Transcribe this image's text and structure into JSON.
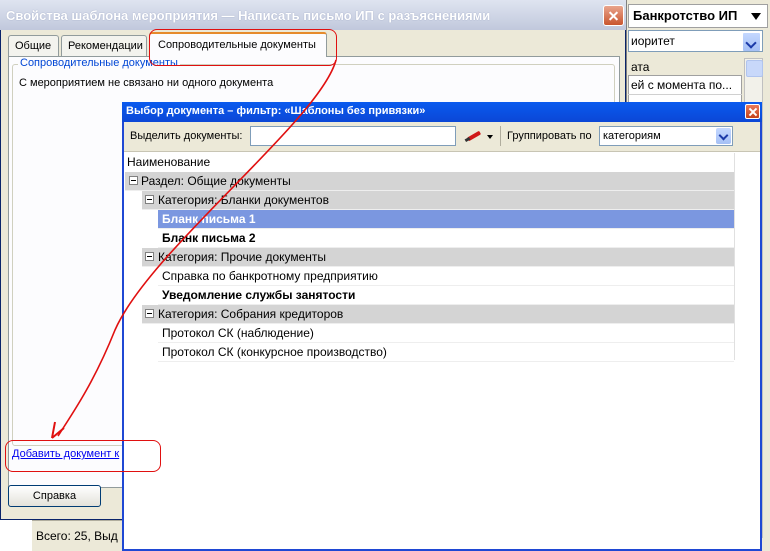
{
  "background_window": {
    "title": "Банкротство ИП",
    "combo_value": "иоритет",
    "column_header": "ата",
    "row_text": "ей с момента по..."
  },
  "dialog": {
    "title": "Свойства шаблона мероприятия — Написать письмо ИП с разъяснениями",
    "tabs": [
      {
        "label": "Общие"
      },
      {
        "label": "Рекомендации"
      },
      {
        "label": "Сопроводительные документы"
      }
    ],
    "group_legend": "Сопроводительные документы",
    "empty_message": "С мероприятием не связано ни одного документа",
    "add_link": "Добавить документ к",
    "help_button": "Справка"
  },
  "status_bar": "Всего: 25, Выд",
  "picker": {
    "title": "Выбор документа – фильтр: «Шаблоны без привязки»",
    "select_label": "Выделить документы:",
    "select_value": "",
    "group_label": "Группировать по",
    "group_value": "категориям",
    "column_header": "Наименование",
    "section": "Раздел: Общие документы",
    "categories": [
      {
        "label": "Категория: Бланки документов",
        "items": [
          {
            "label": "Бланк письма 1",
            "bold": true,
            "selected": true
          },
          {
            "label": "Бланк письма 2",
            "bold": true,
            "selected": false
          }
        ]
      },
      {
        "label": "Категория: Прочие документы",
        "items": [
          {
            "label": "Справка по банкротному предприятию",
            "bold": false,
            "selected": false
          },
          {
            "label": "Уведомление службы занятости",
            "bold": true,
            "selected": false
          }
        ]
      },
      {
        "label": "Категория: Собрания кредиторов",
        "items": [
          {
            "label": "Протокол СК (наблюдение)",
            "bold": false,
            "selected": false
          },
          {
            "label": "Протокол СК (конкурсное производство)",
            "bold": false,
            "selected": false
          }
        ]
      }
    ]
  },
  "colors": {
    "selection": "#7b97e0",
    "group_row": "#d4d4d4",
    "annotation": "#e01010",
    "title_bar": "#0a5bef"
  }
}
